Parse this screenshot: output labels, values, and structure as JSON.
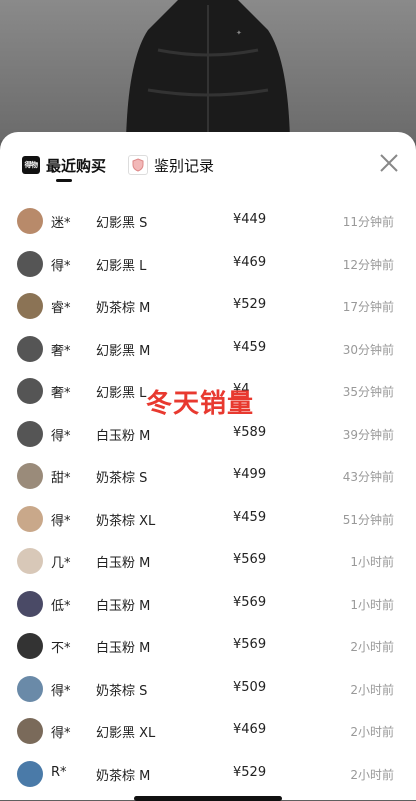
{
  "tabs": [
    {
      "label": "最近购买",
      "icon": "dewu-logo-icon",
      "icon_text": "得物",
      "active": true
    },
    {
      "label": "鉴别记录",
      "icon": "verify-shield-icon",
      "active": false
    }
  ],
  "overlay_text": "冬天销量",
  "colors": {
    "overlay": "#e8392f",
    "time": "#999999",
    "text": "#222222"
  },
  "purchases": [
    {
      "name": "迷*",
      "variant": "幻影黑 S",
      "price": "¥449",
      "time": "11分钟前",
      "avatar": "#b88a6a"
    },
    {
      "name": "得*",
      "variant": "幻影黑 L",
      "price": "¥469",
      "time": "12分钟前",
      "avatar": "#555"
    },
    {
      "name": "睿*",
      "variant": "奶茶棕 M",
      "price": "¥529",
      "time": "17分钟前",
      "avatar": "#8b7355"
    },
    {
      "name": "奢*",
      "variant": "幻影黑 M",
      "price": "¥459",
      "time": "30分钟前",
      "avatar": "#555"
    },
    {
      "name": "奢*",
      "variant": "幻影黑 L",
      "price": "¥4",
      "time": "35分钟前",
      "avatar": "#555"
    },
    {
      "name": "得*",
      "variant": "白玉粉 M",
      "price": "¥589",
      "time": "39分钟前",
      "avatar": "#555"
    },
    {
      "name": "甜*",
      "variant": "奶茶棕 S",
      "price": "¥499",
      "time": "43分钟前",
      "avatar": "#9a8b7a"
    },
    {
      "name": "得*",
      "variant": "奶茶棕 XL",
      "price": "¥459",
      "time": "51分钟前",
      "avatar": "#c9a88a"
    },
    {
      "name": "几*",
      "variant": "白玉粉 M",
      "price": "¥569",
      "time": "1小时前",
      "avatar": "#d8c8b8"
    },
    {
      "name": "低*",
      "variant": "白玉粉 M",
      "price": "¥569",
      "time": "1小时前",
      "avatar": "#4a4a66"
    },
    {
      "name": "不*",
      "variant": "白玉粉 M",
      "price": "¥569",
      "time": "2小时前",
      "avatar": "#333"
    },
    {
      "name": "得*",
      "variant": "奶茶棕 S",
      "price": "¥509",
      "time": "2小时前",
      "avatar": "#6a8aa8"
    },
    {
      "name": "得*",
      "variant": "幻影黑 XL",
      "price": "¥469",
      "time": "2小时前",
      "avatar": "#7a6a5a"
    },
    {
      "name": "R*",
      "variant": "奶茶棕 M",
      "price": "¥529",
      "time": "2小时前",
      "avatar": "#4a7aa8"
    }
  ]
}
